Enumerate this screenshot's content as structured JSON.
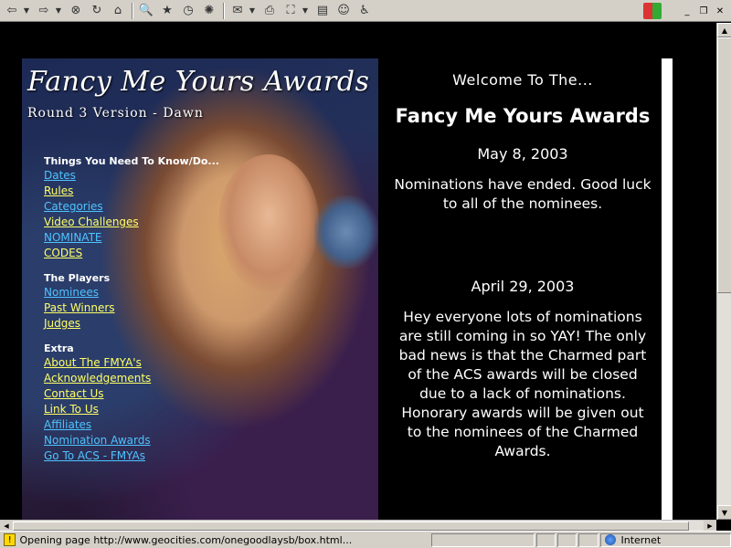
{
  "toolbar": {
    "back_icon": "arrow-left-icon",
    "forward_icon": "arrow-right-icon",
    "stop_icon": "stop-icon",
    "refresh_icon": "refresh-icon",
    "home_icon": "home-icon",
    "search_icon": "search-icon",
    "favorites_icon": "favorites-icon",
    "history_icon": "history-icon",
    "channels_icon": "channels-icon",
    "mail_icon": "mail-icon",
    "print_icon": "print-icon",
    "fullscreen_icon": "fullscreen-icon",
    "edit_icon": "edit-icon",
    "messenger_icon": "messenger-icon",
    "accessibility_icon": "accessibility-icon"
  },
  "window": {
    "minimize": "0",
    "restore": "2",
    "close": "r"
  },
  "banner": {
    "title": "Fancy Me Yours Awards",
    "subtitle": "Round 3 Version - Dawn"
  },
  "nav": {
    "groups": [
      {
        "heading": "Things You Need To Know/Do...",
        "links": [
          {
            "label": "Dates",
            "color": "#4ec3ff"
          },
          {
            "label": "Rules",
            "color": "#ffff66"
          },
          {
            "label": "Categories",
            "color": "#4ec3ff"
          },
          {
            "label": "Video Challenges",
            "color": "#ffff66"
          },
          {
            "label": "NOMINATE",
            "color": "#4ec3ff"
          },
          {
            "label": "CODES",
            "color": "#ffff66"
          }
        ]
      },
      {
        "heading": "The Players",
        "links": [
          {
            "label": "Nominees",
            "color": "#4ec3ff"
          },
          {
            "label": "Past Winners",
            "color": "#ffff66"
          },
          {
            "label": "Judges",
            "color": "#ffff66"
          }
        ]
      },
      {
        "heading": "Extra",
        "links": [
          {
            "label": "About The FMYA's",
            "color": "#ffff66"
          },
          {
            "label": "Acknowledgements",
            "color": "#ffff66"
          },
          {
            "label": "Contact Us",
            "color": "#ffff66"
          },
          {
            "label": "Link To Us",
            "color": "#ffff66"
          },
          {
            "label": "Affiliates",
            "color": "#4ec3ff"
          },
          {
            "label": "Nomination Awards",
            "color": "#4ec3ff"
          },
          {
            "label": "Go To ACS - FMYAs",
            "color": "#4ec3ff"
          }
        ]
      }
    ]
  },
  "main": {
    "welcome": "Welcome To The...",
    "title": "Fancy Me Yours Awards",
    "updates": [
      {
        "date": "May 8, 2003",
        "text": "Nominations have ended.  Good luck to all of the nominees."
      },
      {
        "date": "April 29, 2003",
        "text": "Hey everyone lots of nominations are still coming in so YAY! The only bad news is that the Charmed part of the ACS awards will be closed due to a lack of nominations. Honorary awards will be given out to the nominees of the Charmed Awards."
      }
    ]
  },
  "status": {
    "text": "Opening page http://www.geocities.com/onegoodlaysb/box.html...",
    "zone": "Internet"
  }
}
